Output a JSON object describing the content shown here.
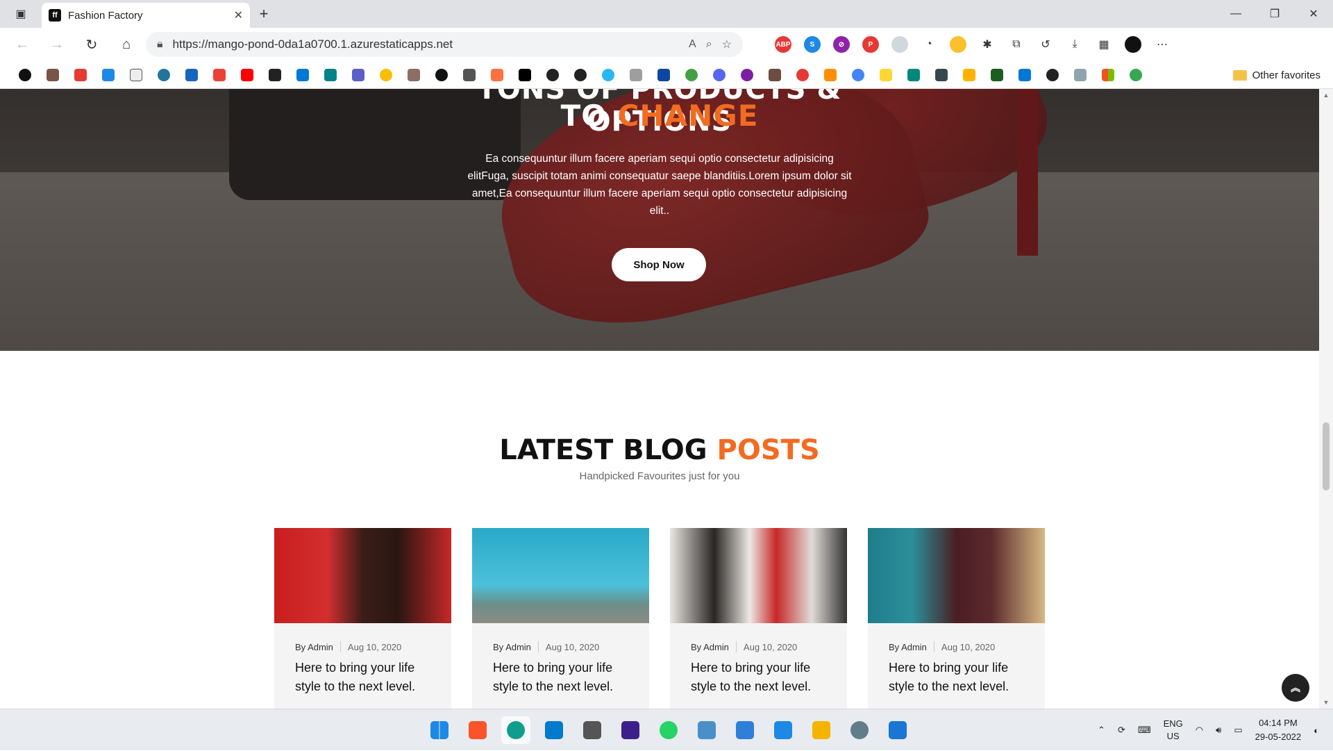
{
  "browser": {
    "tab_title": "Fashion Factory",
    "url": "https://mango-pond-0da1a0700.1.azurestaticapps.net",
    "other_favorites": "Other favorites",
    "new_tab": "+",
    "close_tab": "✕"
  },
  "hero": {
    "title_top": "TONS OF PRODUCTS & OPTIONS",
    "title_prefix": "TO",
    "title_accent": "CHANGE",
    "description": "Ea consequuntur illum facere aperiam sequi optio consectetur adipisicing elitFuga, suscipit totam animi consequatur saepe blanditiis.Lorem ipsum dolor sit amet,Ea consequuntur illum facere aperiam sequi optio consectetur adipisicing elit..",
    "button_label": "Shop Now"
  },
  "blog": {
    "title_prefix": "LATEST BLOG",
    "title_accent": "POSTS",
    "subtitle": "Handpicked Favourites just for you",
    "posts": [
      {
        "author": "By Admin",
        "date": "Aug 10, 2020",
        "title": "Here to bring your life style to the next level."
      },
      {
        "author": "By Admin",
        "date": "Aug 10, 2020",
        "title": "Here to bring your life style to the next level."
      },
      {
        "author": "By Admin",
        "date": "Aug 10, 2020",
        "title": "Here to bring your life style to the next level."
      },
      {
        "author": "By Admin",
        "date": "Aug 10, 2020",
        "title": "Here to bring your life style to the next level."
      }
    ]
  },
  "taskbar": {
    "lang_line1": "ENG",
    "lang_line2": "US",
    "time": "04:14 PM",
    "date": "29-05-2022"
  },
  "colors": {
    "accent": "#f26b21"
  }
}
